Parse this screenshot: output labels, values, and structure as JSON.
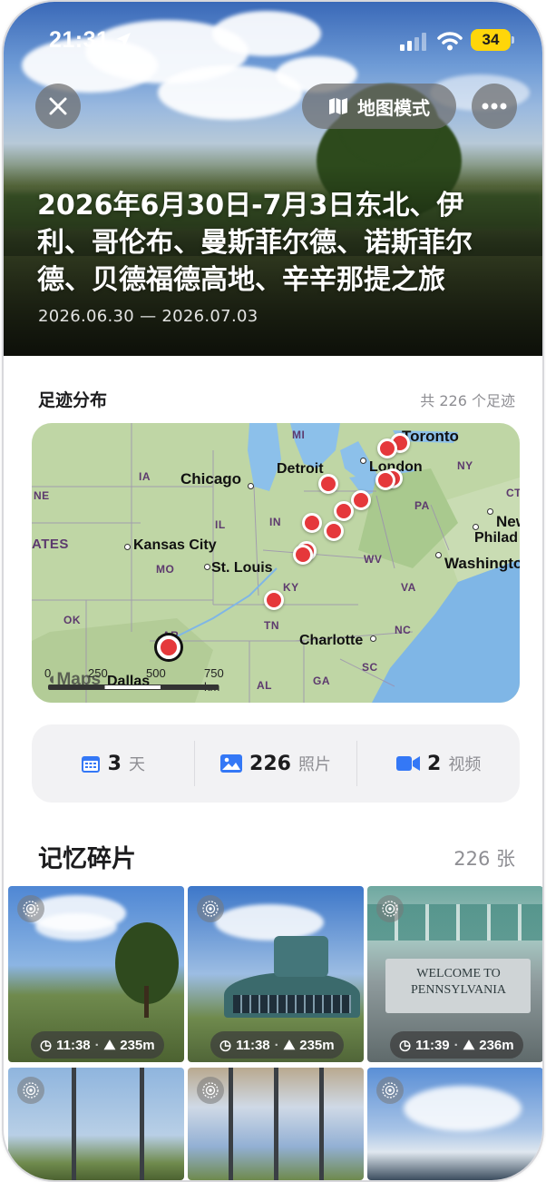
{
  "status_bar": {
    "time": "21:31",
    "battery": "34"
  },
  "header": {
    "map_mode_label": "地图模式"
  },
  "trip": {
    "title": "2026年6月30日-7月3日东北、伊利、哥伦布、曼斯菲尔德、诺斯菲尔德、贝德福德高地、辛辛那提之旅",
    "dates": "2026.06.30 — 2026.07.03"
  },
  "footprints": {
    "title": "足迹分布",
    "count_label": "共 226 个足迹",
    "map": {
      "cities": [
        "Toronto",
        "London",
        "Detroit",
        "Chicago",
        "Kansas City",
        "St. Louis",
        "Washington",
        "Philad",
        "New",
        "Charlotte",
        "Dallas"
      ],
      "states": [
        "MI",
        "NY",
        "IA",
        "IL",
        "IN",
        "PA",
        "MO",
        "WV",
        "VA",
        "KY",
        "TN",
        "NC",
        "OK",
        "AR",
        "SC",
        "GA",
        "AL",
        "NE",
        "CT",
        "ATES"
      ],
      "attribution": "Maps",
      "scale": {
        "0": "0",
        "250": "250",
        "500": "500",
        "750": "750 km"
      }
    }
  },
  "stats": [
    {
      "value": "3",
      "unit": "天",
      "icon": "calendar-icon",
      "color": "#3478f6"
    },
    {
      "value": "226",
      "unit": "照片",
      "icon": "photo-icon",
      "color": "#3478f6"
    },
    {
      "value": "2",
      "unit": "视频",
      "icon": "video-icon",
      "color": "#3478f6"
    }
  ],
  "memories": {
    "title": "记忆碎片",
    "count_label": "226 张",
    "photos": [
      {
        "time": "11:38",
        "altitude": "235m"
      },
      {
        "time": "11:38",
        "altitude": "235m"
      },
      {
        "time": "11:39",
        "altitude": "236m"
      },
      {},
      {},
      {}
    ],
    "photo_text": {
      "welcome_sign": "WELCOME TO PENNSYLVANIA"
    }
  },
  "colors": {
    "accent": "#3478f6",
    "pin": "#e5383b",
    "battery": "#ffd60a"
  }
}
